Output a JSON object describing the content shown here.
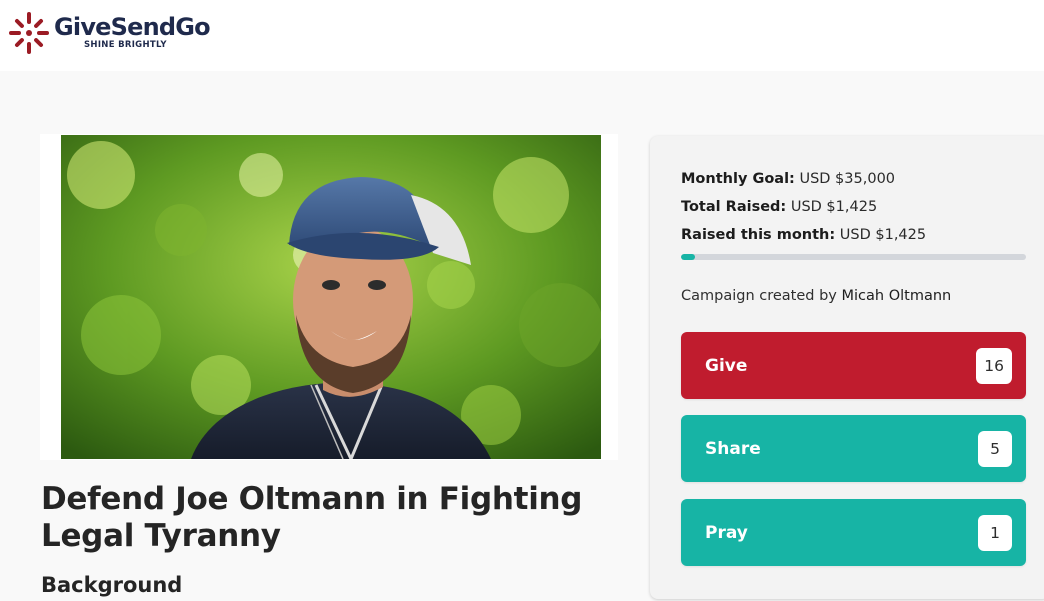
{
  "brand": {
    "name": "GiveSendGo",
    "tagline": "SHINE BRIGHTLY",
    "colors": {
      "navy": "#1f2a4c",
      "red": "#9b1b24"
    }
  },
  "campaign": {
    "photo_icon": "campaign-photo",
    "title": "Defend Joe Oltmann in Fighting Legal Tyranny",
    "section_heading": "Background"
  },
  "stats": {
    "monthly_goal_label": "Monthly Goal:",
    "monthly_goal_value": " USD $35,000",
    "total_raised_label": "Total Raised:",
    "total_raised_value": " USD $1,425",
    "raised_month_label": "Raised this month:",
    "raised_month_value": " USD $1,425",
    "progress_fraction": 0.0407
  },
  "creator": {
    "prefix": "Campaign created by ",
    "name": "Micah Oltmann"
  },
  "actions": {
    "give_label": "Give",
    "give_count": "16",
    "share_label": "Share",
    "share_count": "5",
    "pray_label": "Pray",
    "pray_count": "1",
    "colors": {
      "give": "#c01c2e",
      "share": "#17b4a5",
      "pray": "#17b4a5"
    }
  }
}
